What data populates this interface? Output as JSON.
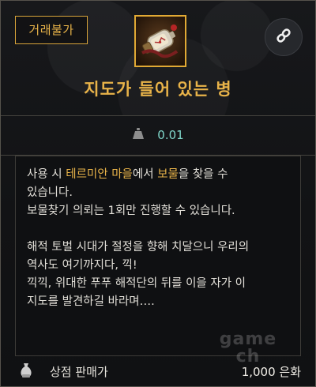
{
  "badge": {
    "label": "거래불가"
  },
  "item": {
    "title": "지도가 들어 있는 병",
    "icon": "map-bottle-icon"
  },
  "weight": {
    "value": "0.01",
    "icon": "weight-icon"
  },
  "description": {
    "line1": {
      "p1": "사용 시 ",
      "h1": "테르미안 마을",
      "p2": "에서 ",
      "h2": "보물",
      "p3": "을 찾을 수"
    },
    "line2": "있습니다.",
    "line3": "보물찾기 의뢰는 1회만 진행할 수 있습니다.",
    "line4": "해적 토벌 시대가 절정을 향해 치달으니 우리의",
    "line5": "역사도 여기까지다, 끽!",
    "line6": "끽끽, 위대한 푸푸 해적단의 뒤를 이을 자가 이",
    "line7": "지도를 발견하길 바라며…."
  },
  "footer": {
    "label": "상점 판매가",
    "price": "1,000 은화",
    "icon": "money-bag-icon"
  },
  "watermark": {
    "line1": "game",
    "line2": "ch"
  },
  "colors": {
    "accent": "#e8b349",
    "weight": "#7fd6c9",
    "background": "#121315"
  }
}
